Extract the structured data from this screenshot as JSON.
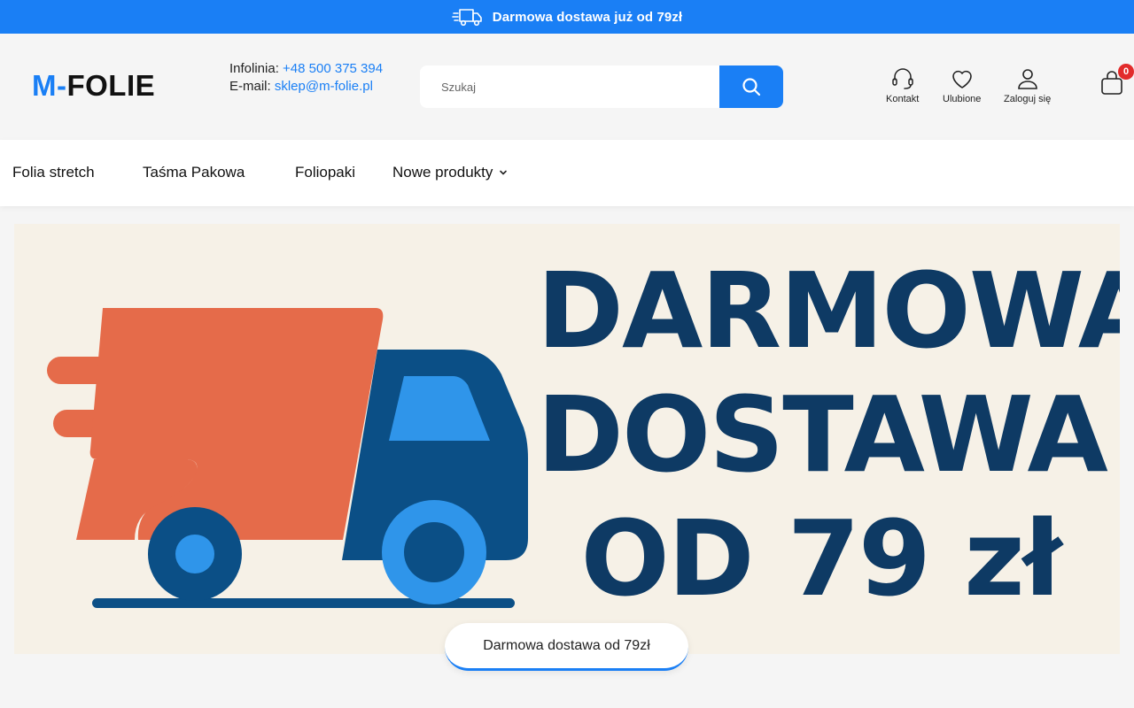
{
  "promo": {
    "text": "Darmowa dostawa już od 79zł",
    "icon": "fast-truck-icon"
  },
  "header": {
    "logo_accent": "M-",
    "logo_rest": "FOLIE",
    "hotline_label": "Infolinia:",
    "hotline_value": "+48 500 375 394",
    "email_label": "E-mail:",
    "email_value": "sklep@m-folie.pl",
    "search_placeholder": "Szukaj",
    "actions": {
      "contact": "Kontakt",
      "favorites": "Ulubione",
      "login": "Zaloguj się"
    },
    "cart_count": "0"
  },
  "nav": {
    "items": [
      {
        "label": "Folia stretch"
      },
      {
        "label": "Taśma Pakowa"
      },
      {
        "label": "Foliopaki"
      },
      {
        "label": "Nowe produkty"
      }
    ]
  },
  "hero": {
    "line1": "DARMOWA",
    "line2": "DOSTAWA",
    "line3": "OD 79 zł",
    "caption": "Darmowa dostawa od 79zł"
  },
  "colors": {
    "accent": "#1a7ff5",
    "hero_bg": "#f6f1e7",
    "hero_text": "#0e3a64",
    "truck_orange": "#e56b4a",
    "truck_blue": "#0b4f86",
    "truck_light_blue": "#2f95ea",
    "badge_red": "#e22b2b"
  }
}
